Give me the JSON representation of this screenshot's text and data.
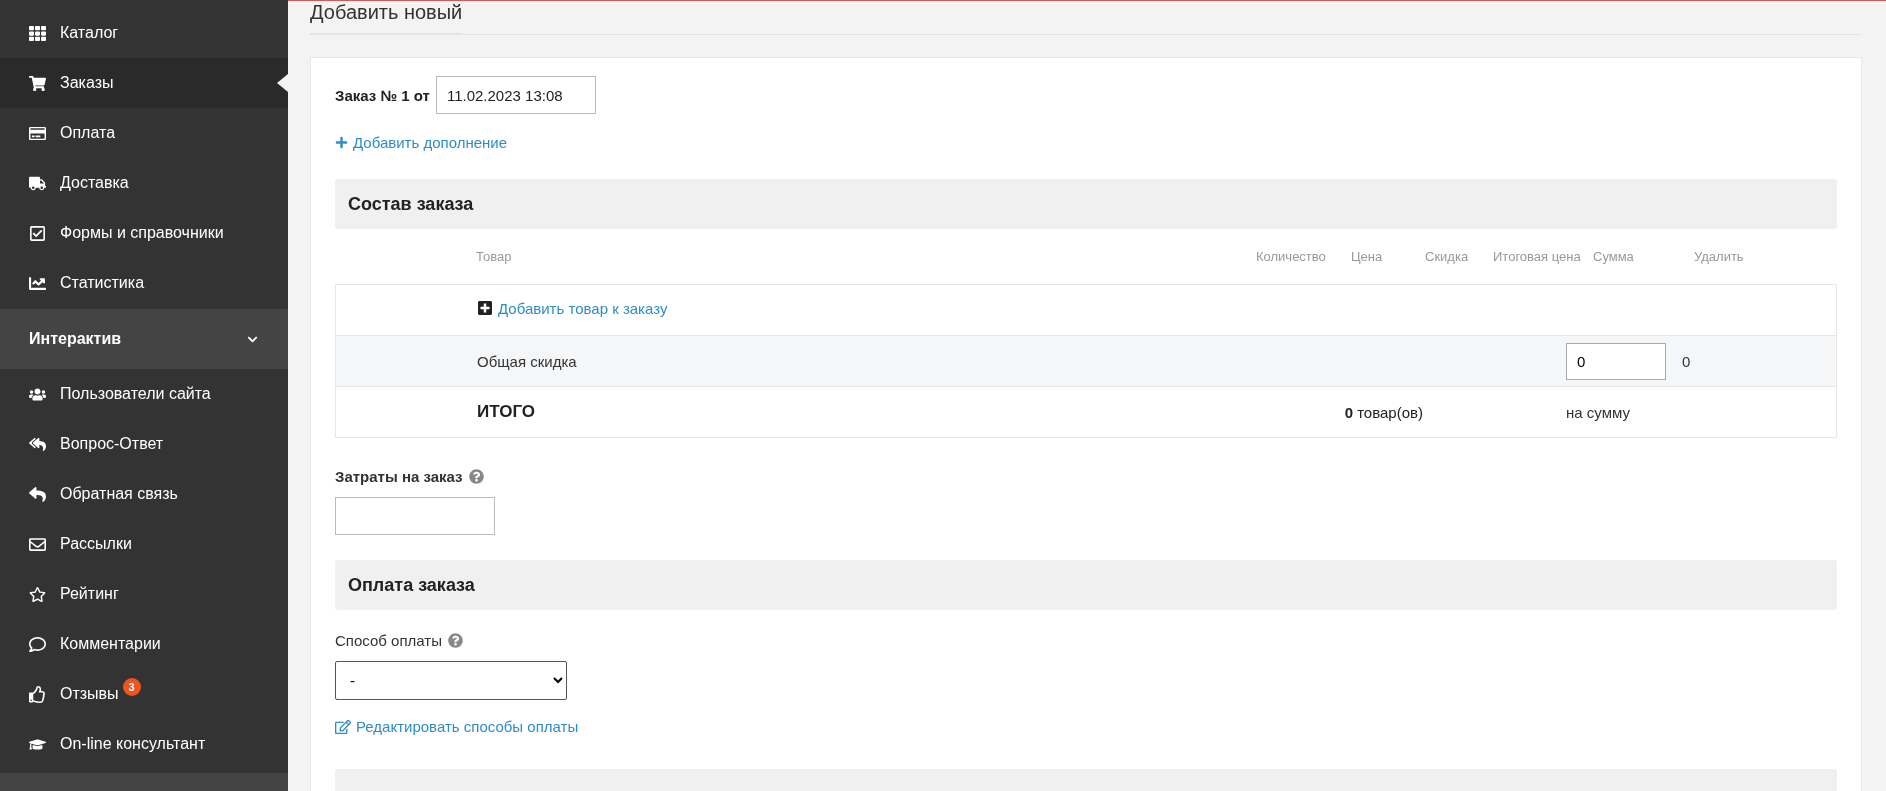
{
  "sidebar": {
    "groups": [
      {
        "items": [
          {
            "label": "Каталог",
            "selected": false
          },
          {
            "label": "Заказы",
            "selected": true
          },
          {
            "label": "Оплата",
            "selected": false
          },
          {
            "label": "Доставка",
            "selected": false
          },
          {
            "label": "Формы и справочники",
            "selected": false
          },
          {
            "label": "Статистика",
            "selected": false
          }
        ]
      },
      {
        "title": "Интерактив",
        "expanded": true,
        "items": [
          {
            "label": "Пользователи сайта",
            "selected": false
          },
          {
            "label": "Вопрос-Ответ",
            "selected": false
          },
          {
            "label": "Обратная связь",
            "selected": false
          },
          {
            "label": "Рассылки",
            "selected": false
          },
          {
            "label": "Рейтинг",
            "selected": false
          },
          {
            "label": "Комментарии",
            "selected": false
          },
          {
            "label": "Отзывы",
            "selected": false,
            "badge": "3"
          },
          {
            "label": "On-line консультант",
            "selected": false
          }
        ]
      }
    ]
  },
  "page": {
    "title": "Добавить новый",
    "order": {
      "label": "Заказ № 1 от",
      "date": "11.02.2023 13:08",
      "add_link": "Добавить дополнение"
    },
    "composition": {
      "title": "Состав заказа",
      "columns": [
        "Товар",
        "Количество",
        "Цена",
        "Скидка",
        "Итоговая цена",
        "Сумма",
        "Удалить"
      ],
      "add_product": "Добавить товар к заказу",
      "discount": {
        "label": "Общая скидка",
        "value": "0",
        "amount": "0"
      },
      "total": {
        "label": "ИТОГО",
        "count": "0",
        "count_unit": "товар(ов)",
        "sum_label": "на сумму"
      }
    },
    "costs": {
      "label": "Затраты на заказ"
    },
    "payment": {
      "title": "Оплата заказа",
      "method_label": "Способ оплаты",
      "method_value": "-",
      "edit_link": "Редактировать способы оплаты"
    }
  }
}
